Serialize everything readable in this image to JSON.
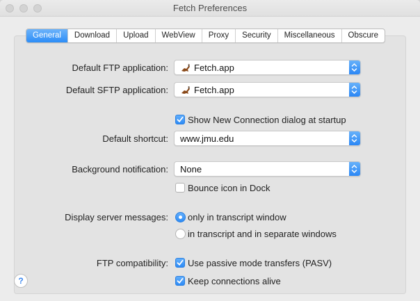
{
  "window": {
    "title": "Fetch Preferences"
  },
  "tabs": [
    {
      "label": "General",
      "active": true
    },
    {
      "label": "Download",
      "active": false
    },
    {
      "label": "Upload",
      "active": false
    },
    {
      "label": "WebView",
      "active": false
    },
    {
      "label": "Proxy",
      "active": false
    },
    {
      "label": "Security",
      "active": false
    },
    {
      "label": "Miscellaneous",
      "active": false
    },
    {
      "label": "Obscure",
      "active": false
    }
  ],
  "general": {
    "ftp_app": {
      "label": "Default FTP application:",
      "value": "Fetch.app",
      "icon": "fetch-dog-icon"
    },
    "sftp_app": {
      "label": "Default SFTP application:",
      "value": "Fetch.app",
      "icon": "fetch-dog-icon"
    },
    "show_new_connection": {
      "label": "Show New Connection dialog at startup",
      "checked": true
    },
    "default_shortcut": {
      "label": "Default shortcut:",
      "value": "www.jmu.edu"
    },
    "background_notification": {
      "label": "Background notification:",
      "value": "None"
    },
    "bounce_icon": {
      "label": "Bounce icon in Dock",
      "checked": false
    },
    "server_messages": {
      "label": "Display server messages:",
      "options": [
        {
          "label": "only in transcript window",
          "selected": true
        },
        {
          "label": "in transcript and in separate windows",
          "selected": false
        }
      ]
    },
    "ftp_compat": {
      "label": "FTP compatibility:",
      "passive": {
        "label": "Use passive mode transfers (PASV)",
        "checked": true
      },
      "keepalive": {
        "label": "Keep connections alive",
        "checked": true
      }
    },
    "help": {
      "glyph": "?"
    }
  },
  "colors": {
    "accent": "#2c8df7",
    "window_bg": "#ececec",
    "panel_bg": "#e3e3e3"
  }
}
